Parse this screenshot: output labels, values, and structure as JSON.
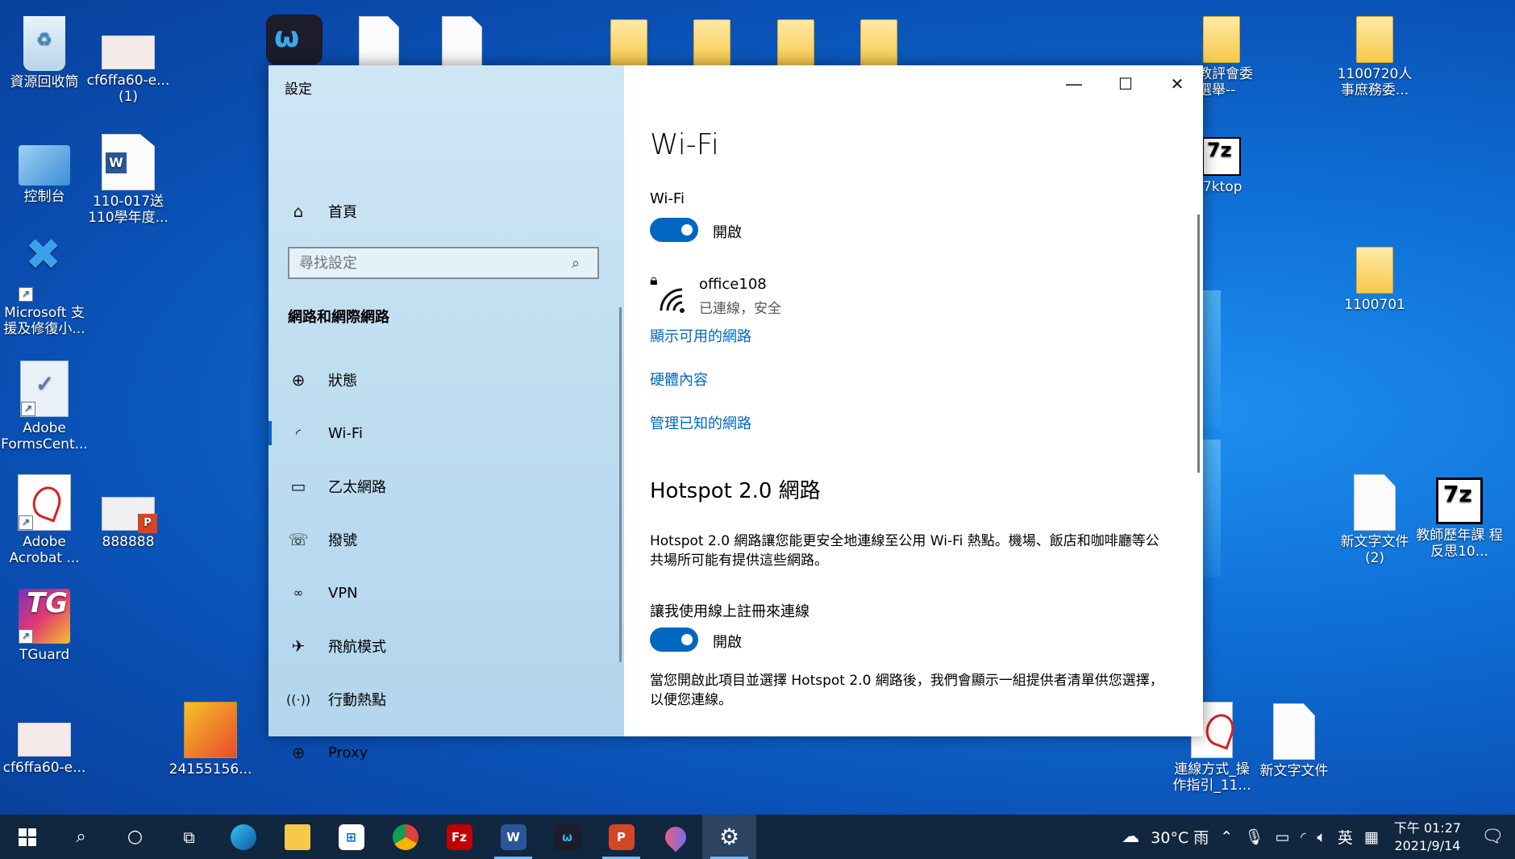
{
  "desktop": {
    "icons_left": [
      {
        "label": "資源回收筒",
        "icon": "recycle-bin-icon"
      },
      {
        "label": "cf6ffa60-e... (1)",
        "icon": "image-file-icon"
      },
      {
        "label": "控制台",
        "icon": "control-panel-icon"
      },
      {
        "label": "110-017送 110學年度...",
        "icon": "word-doc-icon"
      },
      {
        "label": "Microsoft 支援及修復小...",
        "icon": "tools-icon"
      },
      {
        "label": "Adobe FormsCent...",
        "icon": "adobe-forms-icon"
      },
      {
        "label": "Adobe Acrobat ...",
        "icon": "adobe-acrobat-icon"
      },
      {
        "label": "888888",
        "icon": "powerpoint-file-icon"
      },
      {
        "label": "TGuard",
        "icon": "tguard-icon"
      },
      {
        "label": "cf6ffa60-e...",
        "icon": "image-file-icon"
      },
      {
        "label": "24155156...",
        "icon": "image-file-icon"
      }
    ],
    "icons_right": [
      {
        "label": "教評會委 選舉--",
        "icon": "folder-icon"
      },
      {
        "label": "1100720人 事庶務委...",
        "icon": "folder-icon"
      },
      {
        "label": "7ktop",
        "icon": "sevenzip-icon"
      },
      {
        "label": "1100701",
        "icon": "folder-icon"
      },
      {
        "label": "新文字文件 (2)",
        "icon": "text-doc-icon"
      },
      {
        "label": "教師歷年課 程反思10...",
        "icon": "sevenzip-icon"
      },
      {
        "label": "連線方式_操 作指引_11...",
        "icon": "pdf-icon"
      },
      {
        "label": "新文字文件",
        "icon": "text-doc-icon"
      }
    ]
  },
  "settings": {
    "title": "設定",
    "home": "首頁",
    "search_placeholder": "尋找設定",
    "section": "網路和網際網路",
    "nav_items": [
      {
        "label": "狀態",
        "icon": "globe-status-icon"
      },
      {
        "label": "Wi-Fi",
        "icon": "wifi-icon"
      },
      {
        "label": "乙太網路",
        "icon": "ethernet-icon"
      },
      {
        "label": "撥號",
        "icon": "dialup-icon"
      },
      {
        "label": "VPN",
        "icon": "vpn-icon"
      },
      {
        "label": "飛航模式",
        "icon": "airplane-icon"
      },
      {
        "label": "行動熱點",
        "icon": "hotspot-icon"
      },
      {
        "label": "Proxy",
        "icon": "proxy-globe-icon"
      }
    ],
    "selected": "Wi-Fi",
    "content": {
      "heading": "Wi-Fi",
      "wifi_label": "Wi-Fi",
      "wifi_toggle": "開啟",
      "network_name": "office108",
      "network_status": "已連線，安全",
      "links": [
        "顯示可用的網路",
        "硬體內容",
        "管理已知的網路"
      ],
      "hotspot_heading": "Hotspot 2.0 網路",
      "hotspot_desc": "Hotspot 2.0 網路讓您能更安全地連線至公用 Wi-Fi 熱點。機場、飯店和咖啡廳等公共場所可能有提供這些網路。",
      "signup_label": "讓我使用線上註冊來連線",
      "signup_toggle": "開啟",
      "signup_desc": "當您開啟此項目並選擇 Hotspot 2.0 網路後，我們會顯示一組提供者清單供您選擇，以便您連線。"
    }
  },
  "taskbar": {
    "weather": "30°C 雨",
    "ime": "英",
    "time": "下午 01:27",
    "date": "2021/9/14"
  },
  "colors": {
    "accent": "#0067c0",
    "taskbar": "#11263f"
  }
}
